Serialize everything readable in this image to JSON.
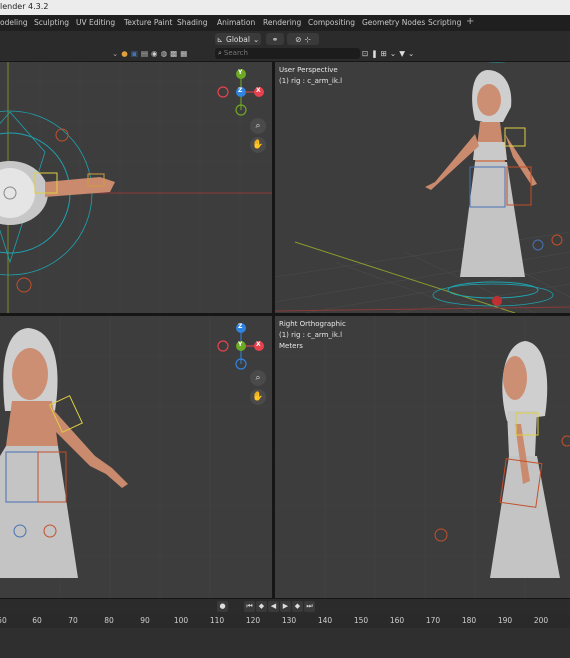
{
  "app": {
    "title": "lender 4.3.2"
  },
  "workspace_tabs": [
    "odeling",
    "Sculpting",
    "UV Editing",
    "Texture Paint",
    "Shading",
    "Animation",
    "Rendering",
    "Compositing",
    "Geometry Nodes",
    "Scripting"
  ],
  "header": {
    "transform_orientation": "Global",
    "search_placeholder": "Search"
  },
  "viewports": {
    "top_right": {
      "label": "User Perspective",
      "subtitle": "(1) rig : c_arm_ik.l"
    },
    "bottom_right": {
      "label": "Right Orthographic",
      "subtitle": "(1) rig : c_arm_ik.l",
      "units": "Meters"
    }
  },
  "gizmo": {
    "x": "X",
    "y": "Y",
    "z": "Z",
    "colors": {
      "x": "#e8414e",
      "y": "#6ea924",
      "z": "#2f83e1"
    }
  },
  "timeline": {
    "frames": [
      "60",
      "70",
      "80",
      "90",
      "100",
      "110",
      "120",
      "130",
      "140",
      "150",
      "160",
      "170",
      "180",
      "190",
      "200"
    ],
    "partial_frame": "50"
  },
  "colors": {
    "viewport_bg": "#3d3d3d",
    "accent": "#4772b3"
  }
}
